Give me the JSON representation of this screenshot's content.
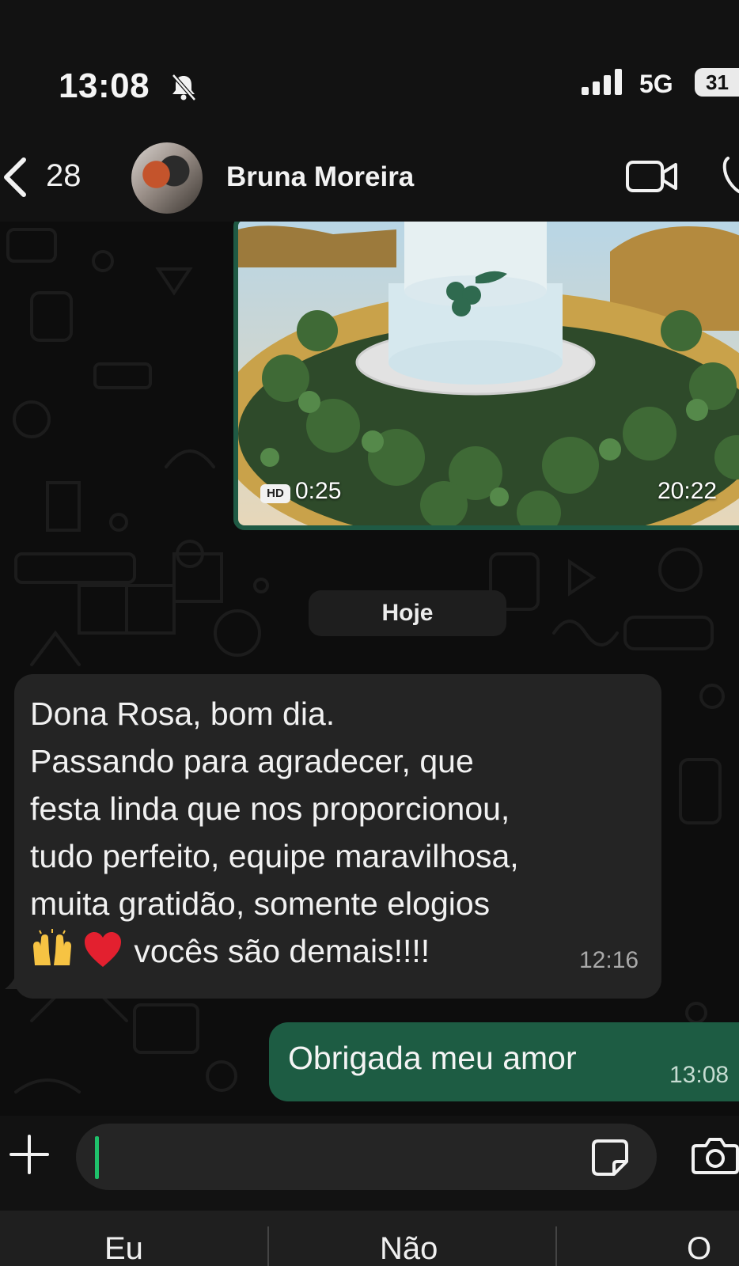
{
  "status_bar": {
    "time": "13:08",
    "network": "5G",
    "battery": "31",
    "icons": [
      "bell-muted-icon",
      "signal-bars-icon"
    ]
  },
  "header": {
    "back_count": "28",
    "contact_name": "Bruna Moreira",
    "icons": [
      "back-chevron-icon",
      "video-call-icon",
      "phone-call-icon"
    ]
  },
  "messages": {
    "video": {
      "hd_label": "HD",
      "duration": "0:25",
      "time": "20:22"
    },
    "date_separator": "Hoje",
    "incoming": {
      "lines": [
        "Dona Rosa, bom dia.",
        "Passando para agradecer, que",
        "festa linda que nos proporcionou,",
        "tudo perfeito, equipe maravilhosa,",
        "muita gratidão, somente elogios",
        "vocês são demais!!!!"
      ],
      "emojis": [
        "raising-hands-emoji",
        "red-heart-emoji"
      ],
      "time": "12:16"
    },
    "outgoing": {
      "text": "Obrigada meu amor",
      "time": "13:08"
    }
  },
  "input_bar": {
    "value": "",
    "icons": [
      "plus-icon",
      "sticker-icon",
      "camera-icon"
    ]
  },
  "keyboard": {
    "suggestions": [
      "Eu",
      "Não",
      "O"
    ]
  },
  "colors": {
    "incoming_bubble": "#242424",
    "outgoing_bubble": "#1d5c43",
    "accent_caret": "#1fc16b"
  }
}
